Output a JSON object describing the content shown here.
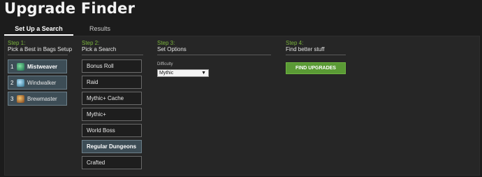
{
  "page": {
    "title": "Upgrade Finder"
  },
  "tabs": [
    {
      "label": "Set Up a Search"
    },
    {
      "label": "Results"
    }
  ],
  "step1": {
    "num": "Step 1:",
    "title": "Pick a Best in Bags Setup",
    "setups": [
      {
        "index": "1",
        "name": "Mistweaver",
        "icon": "mistweaver-spec-icon"
      },
      {
        "index": "2",
        "name": "Windwalker",
        "icon": "windwalker-spec-icon"
      },
      {
        "index": "3",
        "name": "Brewmaster",
        "icon": "brewmaster-spec-icon"
      }
    ]
  },
  "step2": {
    "num": "Step 2:",
    "title": "Pick a Search",
    "items": [
      {
        "label": "Bonus Roll"
      },
      {
        "label": "Raid"
      },
      {
        "label": "Mythic+ Cache"
      },
      {
        "label": "Mythic+"
      },
      {
        "label": "World Boss"
      },
      {
        "label": "Regular Dungeons"
      },
      {
        "label": "Crafted"
      }
    ],
    "selected": "Regular Dungeons"
  },
  "step3": {
    "num": "Step 3:",
    "title": "Set Options",
    "difficulty_label": "Difficulty",
    "difficulty_value": "Mythic"
  },
  "step4": {
    "num": "Step 4:",
    "title": "Find better stuff",
    "button_label": "FIND UPGRADES"
  },
  "colors": {
    "accent_green": "#7ab33c",
    "button_green": "#5a9a35",
    "selected_bg": "#3d4d56"
  }
}
